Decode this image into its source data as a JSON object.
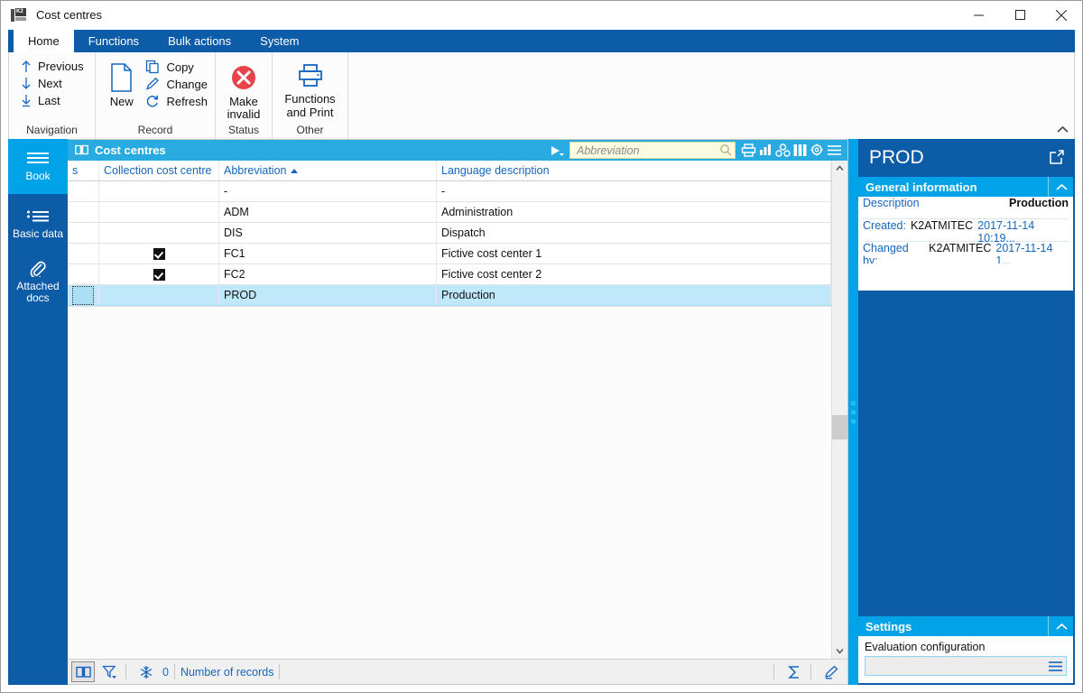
{
  "window": {
    "title": "Cost centres",
    "icon": "k2-app-icon",
    "controls": {
      "minimize": "minimize-icon",
      "maximize": "maximize-icon",
      "close": "close-icon"
    }
  },
  "ribbon": {
    "tabs": [
      {
        "label": "Home",
        "active": true
      },
      {
        "label": "Functions",
        "active": false
      },
      {
        "label": "Bulk actions",
        "active": false
      },
      {
        "label": "System",
        "active": false
      }
    ],
    "groups": [
      {
        "label": "Navigation",
        "items": [
          {
            "label": "Previous",
            "icon": "arrow-up-icon"
          },
          {
            "label": "Next",
            "icon": "arrow-down-icon"
          },
          {
            "label": "Last",
            "icon": "arrow-down-to-line-icon"
          }
        ]
      },
      {
        "label": "Record",
        "big": {
          "label": "New",
          "icon": "new-document-icon"
        },
        "items": [
          {
            "label": "Copy",
            "icon": "copy-icon"
          },
          {
            "label": "Change",
            "icon": "pencil-icon"
          },
          {
            "label": "Refresh",
            "icon": "refresh-icon"
          }
        ]
      },
      {
        "label": "Status",
        "big": {
          "label": "Make invalid",
          "icon": "red-x-circle-icon"
        }
      },
      {
        "label": "Other",
        "big": {
          "label": "Functions and Print",
          "icon": "printer-icon"
        }
      }
    ],
    "collapse_icon": "chevron-up-icon"
  },
  "sidebar": {
    "items": [
      {
        "label": "Book",
        "icon": "book-lines-icon",
        "active": true
      },
      {
        "label": "Basic data",
        "icon": "list-icon",
        "active": false
      },
      {
        "label": "Attached docs",
        "icon": "paperclip-icon",
        "active": false
      }
    ]
  },
  "grid": {
    "header": {
      "icon": "book-open-icon",
      "title": "Cost centres",
      "play_icon": "play-dropdown-icon",
      "search": {
        "placeholder": "Abbreviation",
        "value": "",
        "icon": "magnifier-icon"
      },
      "tools": [
        {
          "name": "print-icon"
        },
        {
          "name": "chart-icon"
        },
        {
          "name": "group-icon"
        },
        {
          "name": "columns-icon"
        },
        {
          "name": "gear-icon"
        },
        {
          "name": "menu-icon"
        }
      ]
    },
    "columns": [
      {
        "key": "s",
        "label": "s",
        "sorted": false
      },
      {
        "key": "collection",
        "label": "Collection cost centre",
        "sorted": false
      },
      {
        "key": "abbreviation",
        "label": "Abbreviation",
        "sorted": true,
        "sort_dir": "asc"
      },
      {
        "key": "language_description",
        "label": "Language description",
        "sorted": false
      }
    ],
    "rows": [
      {
        "s": "",
        "collection": false,
        "abbreviation": "-",
        "language_description": "-",
        "selected": false
      },
      {
        "s": "",
        "collection": false,
        "abbreviation": "ADM",
        "language_description": "Administration",
        "selected": false
      },
      {
        "s": "",
        "collection": false,
        "abbreviation": "DIS",
        "language_description": "Dispatch",
        "selected": false
      },
      {
        "s": "",
        "collection": true,
        "abbreviation": "FC1",
        "language_description": "Fictive cost center 1",
        "selected": false
      },
      {
        "s": "",
        "collection": true,
        "abbreviation": "FC2",
        "language_description": "Fictive cost center 2",
        "selected": false
      },
      {
        "s": "",
        "collection": false,
        "abbreviation": "PROD",
        "language_description": "Production",
        "selected": true
      }
    ],
    "scrollbar": {
      "up_icon": "chevron-up-icon",
      "down_icon": "chevron-down-icon"
    }
  },
  "statusbar": {
    "book_icon": "book-open-icon",
    "filter_icon": "filter-funnel-icon",
    "snowflake_icon": "snowflake-icon",
    "count": "0",
    "records_label": "Number of records",
    "sum_icon": "sigma-icon",
    "edit_icon": "pencil-icon"
  },
  "right_panel": {
    "title": "PROD",
    "popout_icon": "external-link-icon",
    "sections": [
      {
        "title": "General information",
        "collapse_icon": "chevron-up-icon",
        "rows": [
          {
            "type": "kv",
            "label": "Description",
            "value": "Production"
          },
          {
            "type": "audit",
            "label": "Created:",
            "user": "K2ATMITEC",
            "stamp": "2017-11-14 10:19..."
          },
          {
            "type": "audit",
            "label": "Changed by:",
            "user": "K2ATMITEC",
            "stamp": "2017-11-14 1..."
          }
        ]
      },
      {
        "title": "Settings",
        "collapse_icon": "chevron-up-icon",
        "field_label": "Evaluation configuration",
        "field_value": "",
        "field_button_icon": "menu-icon"
      }
    ]
  },
  "colors": {
    "ribbon_blue": "#0d5ca7",
    "accent_cyan": "#00a2e8",
    "grid_header_cyan": "#29abe2",
    "selection": "#bfe9fb",
    "link_blue": "#1565c0",
    "danger_red": "#e8434a"
  }
}
